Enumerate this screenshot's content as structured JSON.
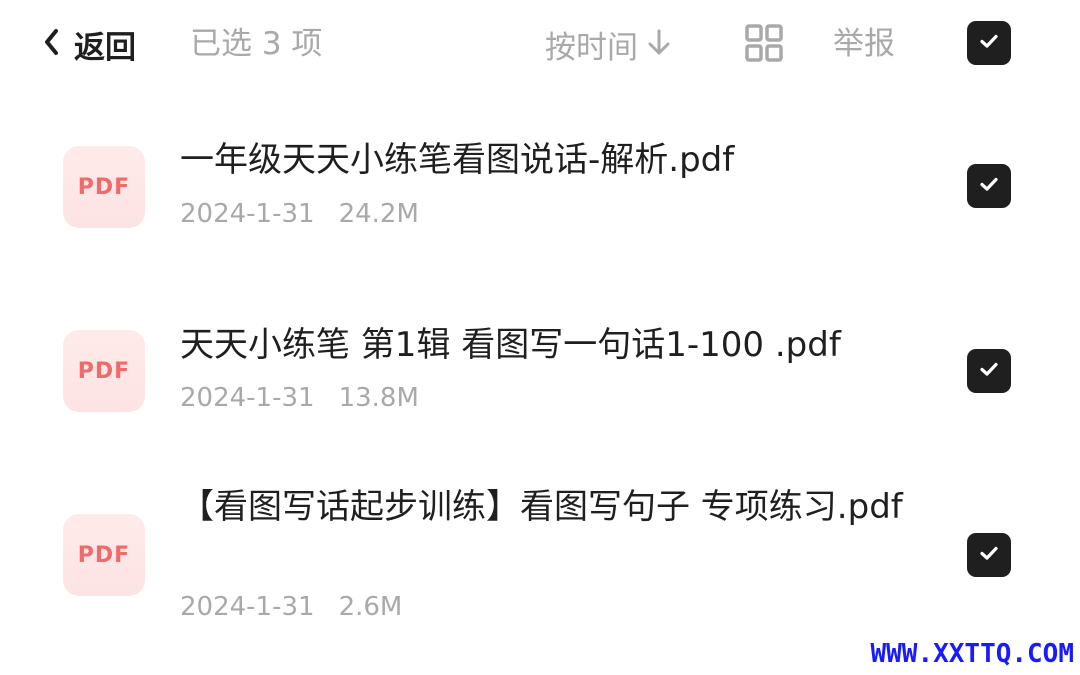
{
  "header": {
    "back_label": "返回",
    "selected_text": "已选 3 项",
    "sort_label": "按时间",
    "report_label": "举报",
    "select_all_checked": true
  },
  "files": [
    {
      "icon_label": "PDF",
      "name": "一年级天天小练笔看图说话-解析.pdf",
      "date": "2024-1-31",
      "size": "24.2M",
      "checked": true
    },
    {
      "icon_label": "PDF",
      "name": "天天小练笔 第1辑 看图写一句话1-100 .pdf",
      "date": "2024-1-31",
      "size": "13.8M",
      "checked": true
    },
    {
      "icon_label": "PDF",
      "name": "【看图写话起步训练】看图写句子 专项练习.pdf",
      "date": "2024-1-31",
      "size": "2.6M",
      "checked": true
    }
  ],
  "watermark": "WWW.XXTTQ.COM",
  "colors": {
    "checkbox": "#1f1f1f",
    "muted_text": "#a9a9a9",
    "pdf_text": "#f06a6a",
    "pdf_bg": "#fde6e6",
    "watermark": "#1a1aff"
  }
}
